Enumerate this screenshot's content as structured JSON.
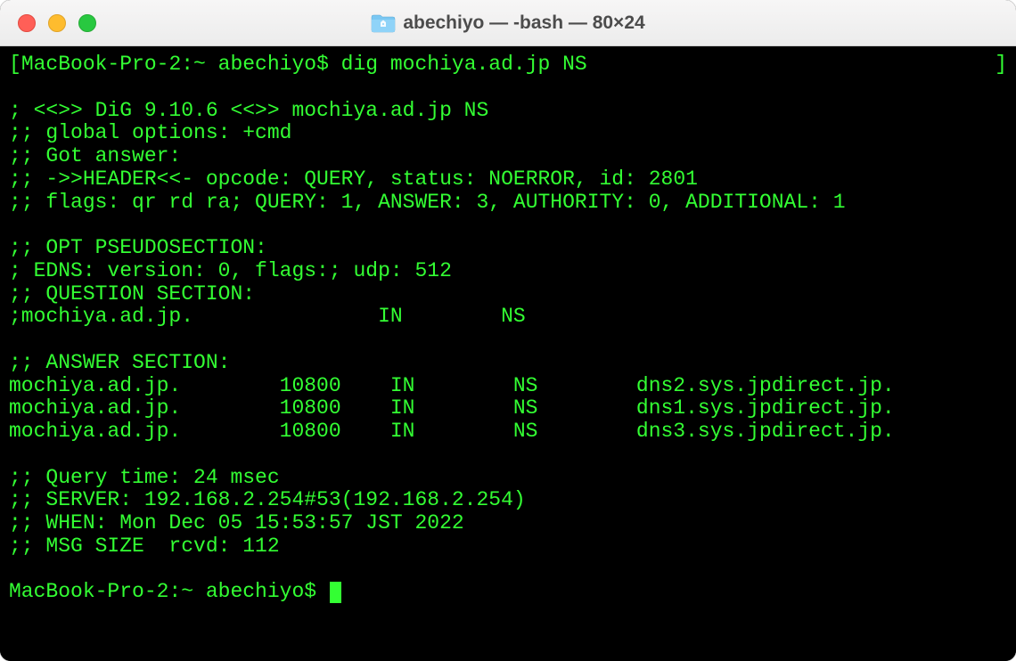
{
  "window": {
    "title": "abechiyo — -bash — 80×24",
    "traffic_lights": [
      "close",
      "minimize",
      "maximize"
    ]
  },
  "prompt1": {
    "host": "MacBook-Pro-2",
    "path": "~",
    "user": "abechiyo",
    "full": "MacBook-Pro-2:~ abechiyo$ ",
    "command": "dig mochiya.ad.jp NS",
    "left_bracket": "[",
    "right_bracket": "]"
  },
  "dig": {
    "banner": "; <<>> DiG 9.10.6 <<>> mochiya.ad.jp NS",
    "global_options": ";; global options: +cmd",
    "got_answer": ";; Got answer:",
    "header": ";; ->>HEADER<<- opcode: QUERY, status: NOERROR, id: 2801",
    "flags": ";; flags: qr rd ra; QUERY: 1, ANSWER: 3, AUTHORITY: 0, ADDITIONAL: 1",
    "opt_header": ";; OPT PSEUDOSECTION:",
    "edns": "; EDNS: version: 0, flags:; udp: 512",
    "question_header": ";; QUESTION SECTION:",
    "question": {
      "name": ";mochiya.ad.jp.",
      "class": "IN",
      "type": "NS"
    },
    "answer_header": ";; ANSWER SECTION:",
    "answers": [
      {
        "name": "mochiya.ad.jp.",
        "ttl": "10800",
        "class": "IN",
        "type": "NS",
        "data": "dns2.sys.jpdirect.jp."
      },
      {
        "name": "mochiya.ad.jp.",
        "ttl": "10800",
        "class": "IN",
        "type": "NS",
        "data": "dns1.sys.jpdirect.jp."
      },
      {
        "name": "mochiya.ad.jp.",
        "ttl": "10800",
        "class": "IN",
        "type": "NS",
        "data": "dns3.sys.jpdirect.jp."
      }
    ],
    "query_time": ";; Query time: 24 msec",
    "server": ";; SERVER: 192.168.2.254#53(192.168.2.254)",
    "when": ";; WHEN: Mon Dec 05 15:53:57 JST 2022",
    "msg_size": ";; MSG SIZE  rcvd: 112"
  },
  "prompt2": {
    "full": "MacBook-Pro-2:~ abechiyo$ "
  }
}
